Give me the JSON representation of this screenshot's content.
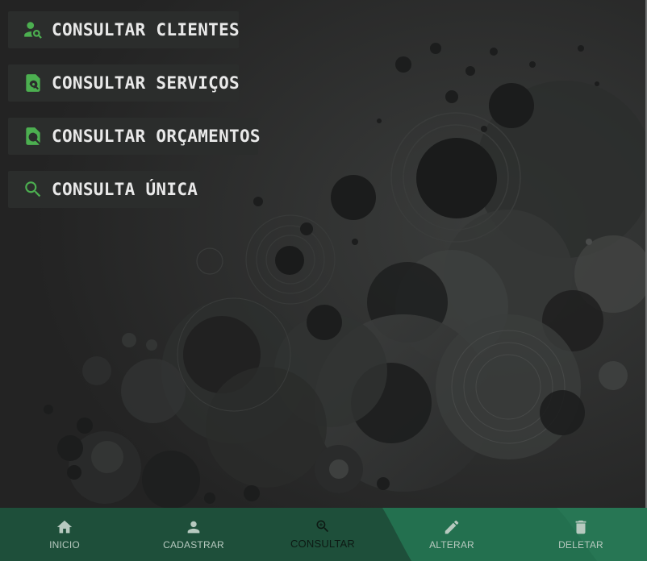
{
  "menu": {
    "items": [
      {
        "label": "CONSULTAR CLIENTES",
        "icon": "person-search-icon"
      },
      {
        "label": "CONSULTAR SERVIÇOS",
        "icon": "document-search-icon"
      },
      {
        "label": "CONSULTAR ORÇAMENTOS",
        "icon": "file-search-icon"
      },
      {
        "label": "CONSULTA ÚNICA",
        "icon": "search-icon"
      }
    ]
  },
  "bottom_nav": {
    "active": "CONSULTAR",
    "items": [
      {
        "label": "INICIO",
        "icon": "home-icon"
      },
      {
        "label": "CADASTRAR",
        "icon": "person-icon"
      },
      {
        "label": "CONSULTAR",
        "icon": "zoom-search-icon"
      },
      {
        "label": "ALTERAR",
        "icon": "pencil-icon"
      },
      {
        "label": "DELETAR",
        "icon": "trash-icon"
      }
    ]
  },
  "colors": {
    "background": "#242424",
    "menu_item_bg": "#2b2d2c",
    "menu_icon": "#4caf50",
    "menu_text": "#e9e9e9",
    "nav_bg": "#1e4f3a",
    "nav_accent": "#23704f",
    "nav_text": "#b7c9bf",
    "nav_active_text": "#0d1a14"
  }
}
